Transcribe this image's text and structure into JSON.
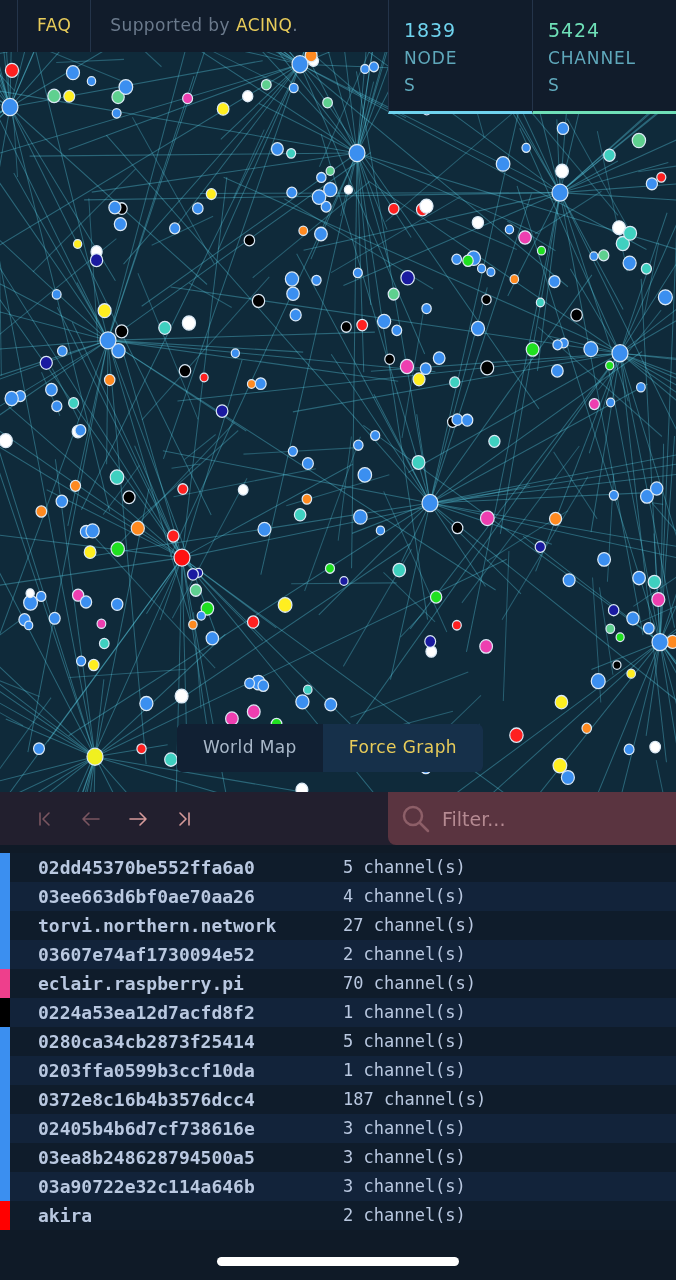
{
  "header": {
    "faq": "FAQ",
    "sponsor": {
      "prefix": "Supported by",
      "link": "ACINQ",
      "suffix": "."
    }
  },
  "stats": [
    {
      "value": "1839",
      "label": "NODES",
      "color": "#6fd3ee"
    },
    {
      "value": "5424",
      "label": "CHANNELS",
      "color": "#6fe0b8"
    }
  ],
  "view_tabs": [
    {
      "label": "World Map",
      "selected": false
    },
    {
      "label": "Force Graph",
      "selected": true
    }
  ],
  "pager": [
    {
      "kind": "first",
      "disabled": true
    },
    {
      "kind": "prev",
      "disabled": true
    },
    {
      "kind": "next",
      "disabled": false
    },
    {
      "kind": "last",
      "disabled": false
    }
  ],
  "filter": {
    "placeholder": "Filter..."
  },
  "rows": [
    {
      "name": "02dd45370be552ffa6a0",
      "channels": "5 channel(s)",
      "color": "#3b8ff0"
    },
    {
      "name": "03ee663d6bf0ae70aa26",
      "channels": "4 channel(s)",
      "color": "#3b8ff0"
    },
    {
      "name": "torvi.northern.network",
      "channels": "27 channel(s)",
      "color": "#3b8ff0"
    },
    {
      "name": "03607e74af1730094e52",
      "channels": "2 channel(s)",
      "color": "#3b8ff0"
    },
    {
      "name": "eclair.raspberry.pi",
      "channels": "70 channel(s)",
      "color": "#ee3f8c"
    },
    {
      "name": "0224a53ea12d7acfd8f2",
      "channels": "1 channel(s)",
      "color": "#000000"
    },
    {
      "name": "0280ca34cb2873f25414",
      "channels": "5 channel(s)",
      "color": "#3b8ff0"
    },
    {
      "name": "0203ffa0599b3ccf10da",
      "channels": "1 channel(s)",
      "color": "#3b8ff0"
    },
    {
      "name": "0372e8c16b4b3576dcc4",
      "channels": "187 channel(s)",
      "color": "#3b8ff0"
    },
    {
      "name": "02405b4b6d7cf738616e",
      "channels": "3 channel(s)",
      "color": "#3b8ff0"
    },
    {
      "name": "03ea8b248628794500a5",
      "channels": "3 channel(s)",
      "color": "#3b8ff0"
    },
    {
      "name": "03a90722e32c114a646b",
      "channels": "3 channel(s)",
      "color": "#3b8ff0"
    },
    {
      "name": "akira",
      "channels": "2 channel(s)",
      "color": "#ff0000"
    }
  ]
}
